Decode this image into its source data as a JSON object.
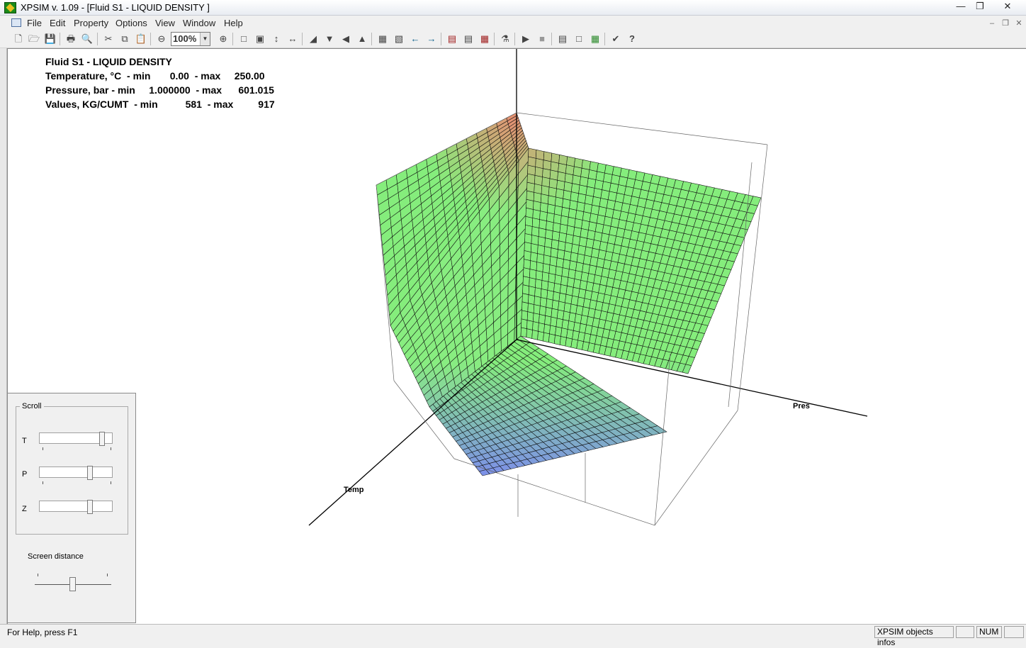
{
  "window": {
    "title": "XPSIM  v. 1.09 - [Fluid S1 - LIQUID DENSITY         ]"
  },
  "menu": [
    "File",
    "Edit",
    "Property",
    "Options",
    "View",
    "Window",
    "Help"
  ],
  "toolbar": {
    "zoom": "100%"
  },
  "info": {
    "line1": "Fluid S1 - LIQUID DENSITY",
    "line2": "Temperature, °C  - min       0.00  - max     250.00",
    "line3": "Pressure, bar - min     1.000000  - max      601.015",
    "line4": "Values, KG/CUMT  - min          581  - max         917"
  },
  "plot": {
    "axis_temp_label": "Temp",
    "axis_pres_label": "Pres"
  },
  "panel": {
    "group_title": "Scroll",
    "sliders": [
      {
        "label": "T",
        "position": 0.88
      },
      {
        "label": "P",
        "position": 0.7
      },
      {
        "label": "Z",
        "position": 0.7
      }
    ],
    "screen_distance_label": "Screen distance",
    "screen_distance_position": 0.5
  },
  "statusbar": {
    "help_text": "For Help, press F1",
    "objects_info": "XPSIM objects infos",
    "num": "NUM"
  }
}
